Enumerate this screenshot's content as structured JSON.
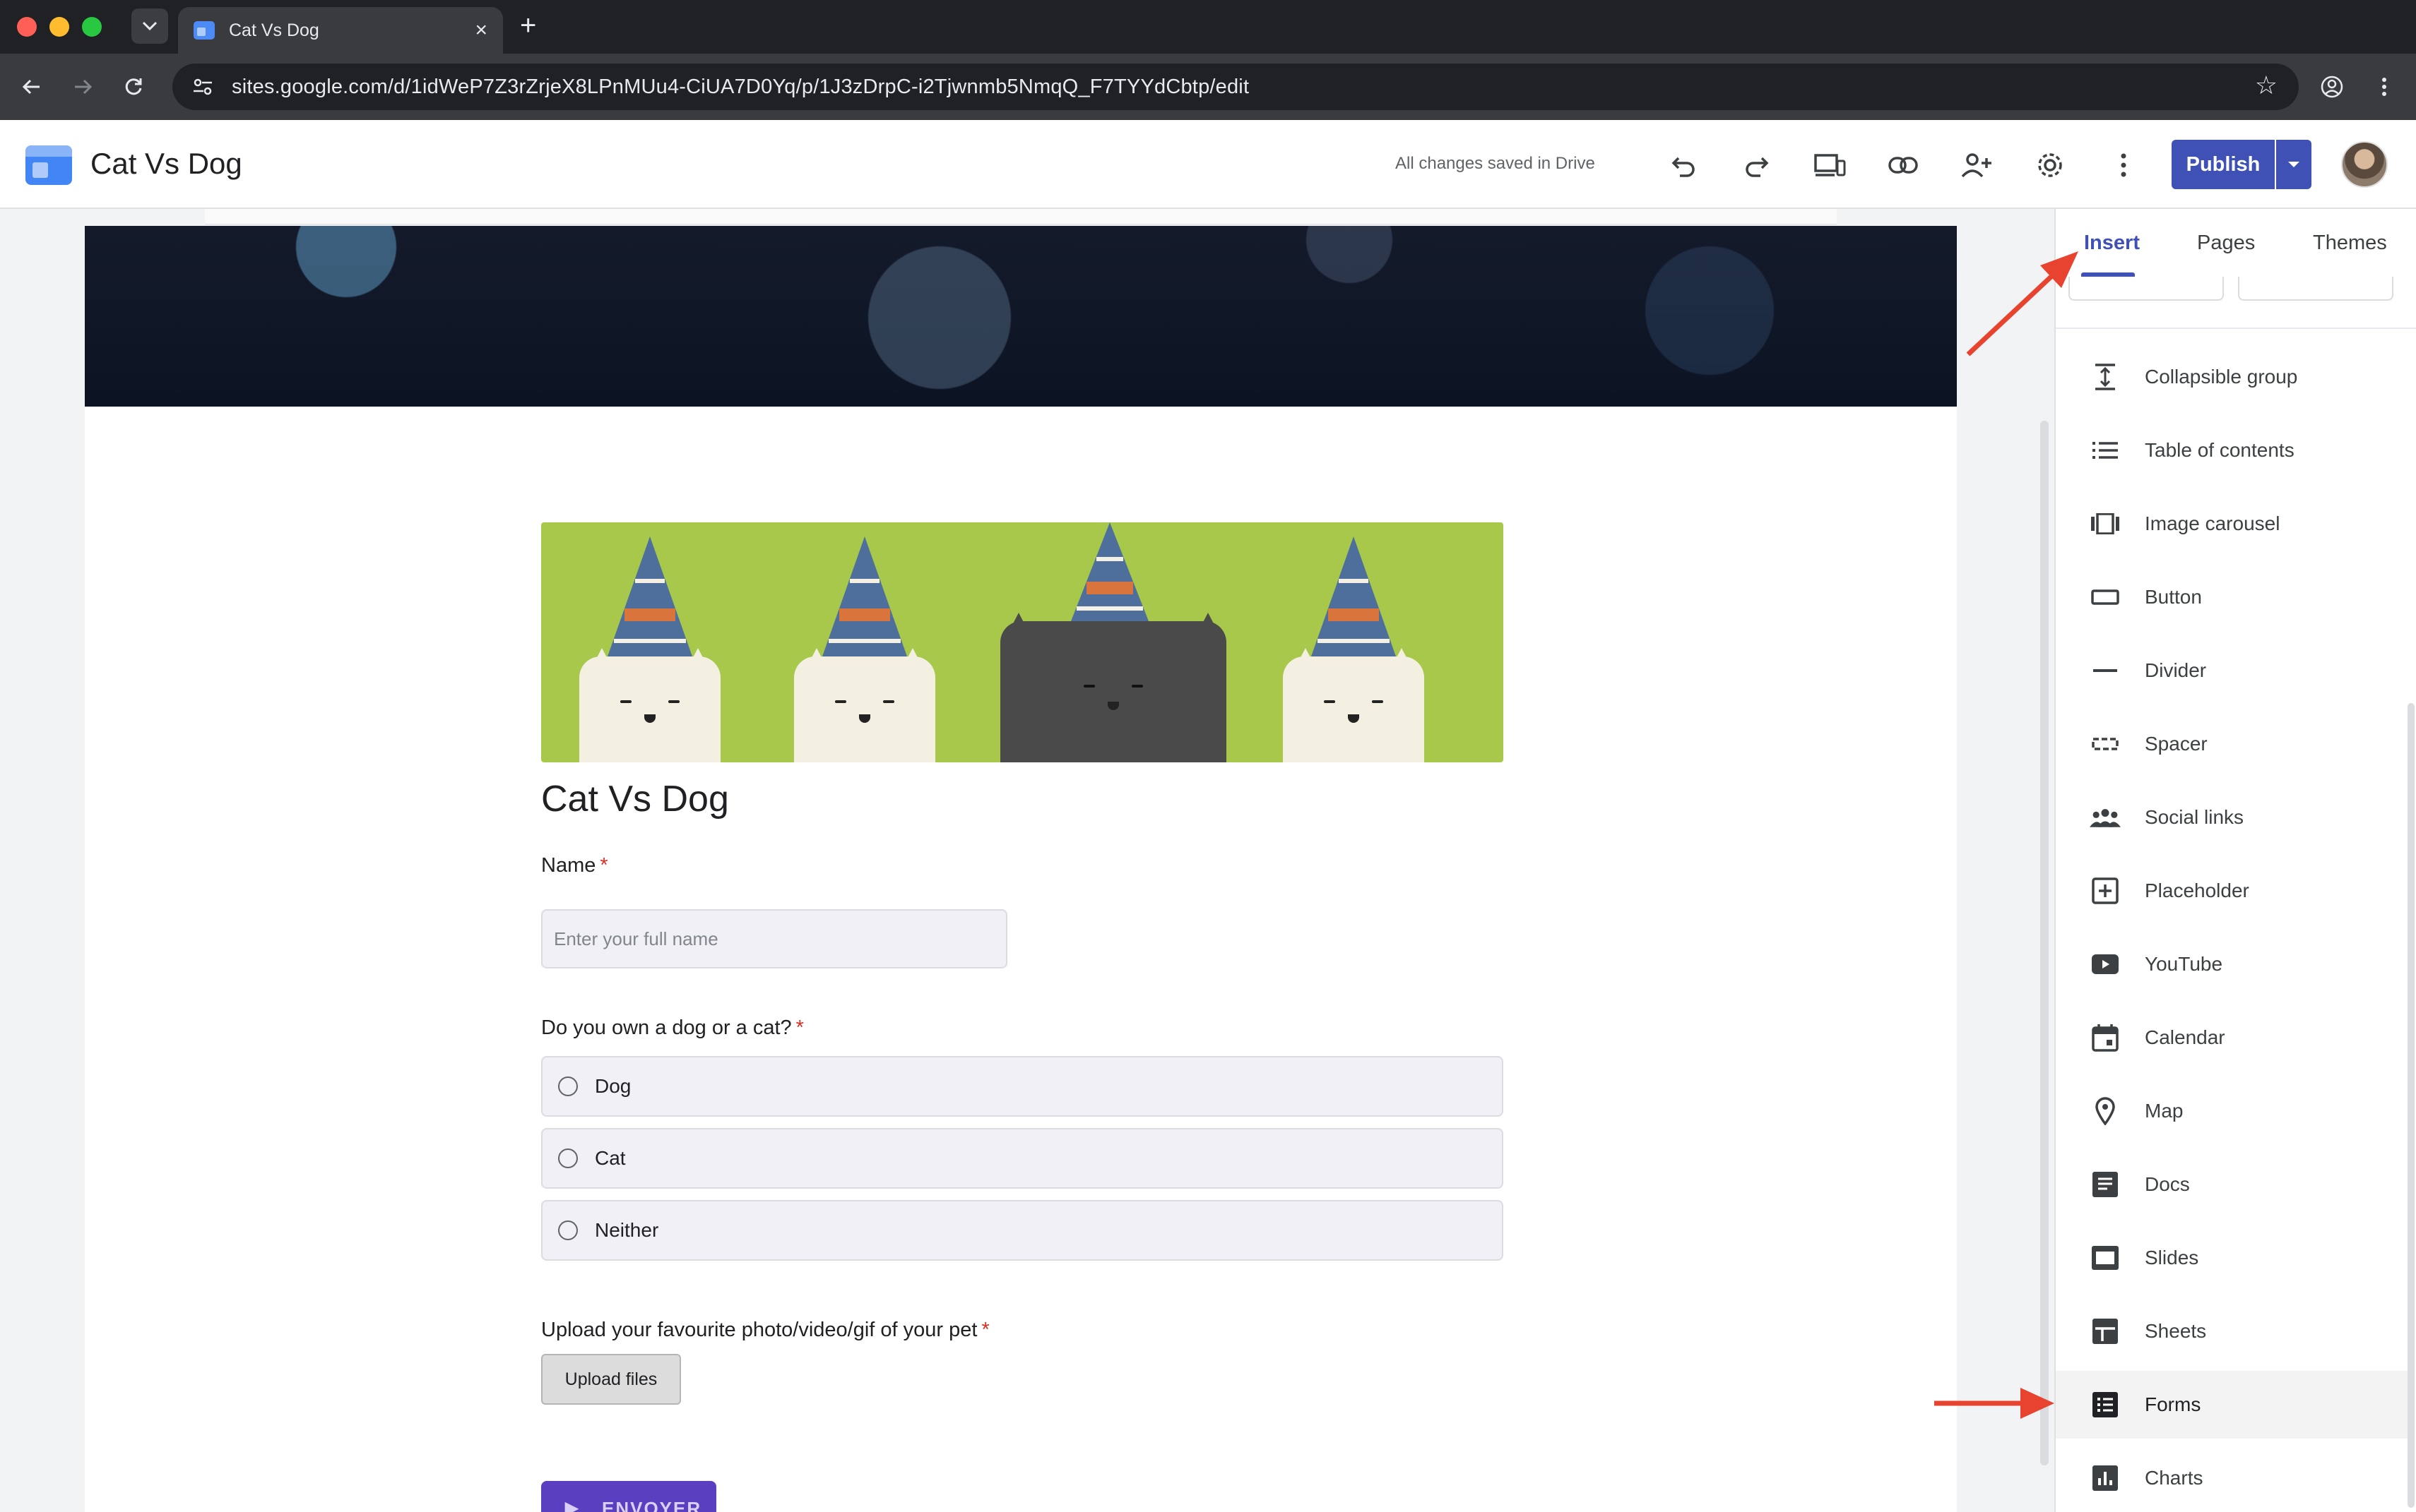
{
  "browser": {
    "tab_title": "Cat Vs Dog",
    "url": "sites.google.com/d/1idWeP7Z3rZrjeX8LPnMUu4-CiUA7D0Yq/p/1J3zDrpC-i2Tjwnmb5NmqQ_F7TYYdCbtp/edit"
  },
  "app": {
    "title": "Cat Vs Dog",
    "save_status": "All changes saved in Drive",
    "publish_label": "Publish"
  },
  "form": {
    "title": "Cat Vs Dog",
    "name_question": "Name",
    "name_placeholder": "Enter your full name",
    "pet_question": "Do you own a dog or a cat?",
    "options": [
      "Dog",
      "Cat",
      "Neither"
    ],
    "upload_question": "Upload your favourite photo/video/gif of your pet",
    "upload_button": "Upload files",
    "submit_label": "ENVOYER",
    "required_marker": "*"
  },
  "panel": {
    "tabs": [
      "Insert",
      "Pages",
      "Themes"
    ],
    "active_tab": "Insert",
    "items": [
      {
        "label": "Collapsible group",
        "icon": "collapsible-icon"
      },
      {
        "label": "Table of contents",
        "icon": "list-icon"
      },
      {
        "label": "Image carousel",
        "icon": "carousel-icon"
      },
      {
        "label": "Button",
        "icon": "button-icon"
      },
      {
        "label": "Divider",
        "icon": "divider-icon"
      },
      {
        "label": "Spacer",
        "icon": "spacer-icon"
      },
      {
        "label": "Social links",
        "icon": "people-icon"
      },
      {
        "label": "Placeholder",
        "icon": "plus-box-icon"
      },
      {
        "label": "YouTube",
        "icon": "youtube-icon"
      },
      {
        "label": "Calendar",
        "icon": "calendar-icon"
      },
      {
        "label": "Map",
        "icon": "map-pin-icon"
      },
      {
        "label": "Docs",
        "icon": "docs-icon"
      },
      {
        "label": "Slides",
        "icon": "slides-icon"
      },
      {
        "label": "Sheets",
        "icon": "sheets-icon"
      },
      {
        "label": "Forms",
        "icon": "forms-icon"
      },
      {
        "label": "Charts",
        "icon": "charts-icon"
      }
    ]
  },
  "colors": {
    "publish": "#3f51b5",
    "annotation_arrow": "#e8432f",
    "submit": "#5b3fc1",
    "required": "#d93025"
  }
}
